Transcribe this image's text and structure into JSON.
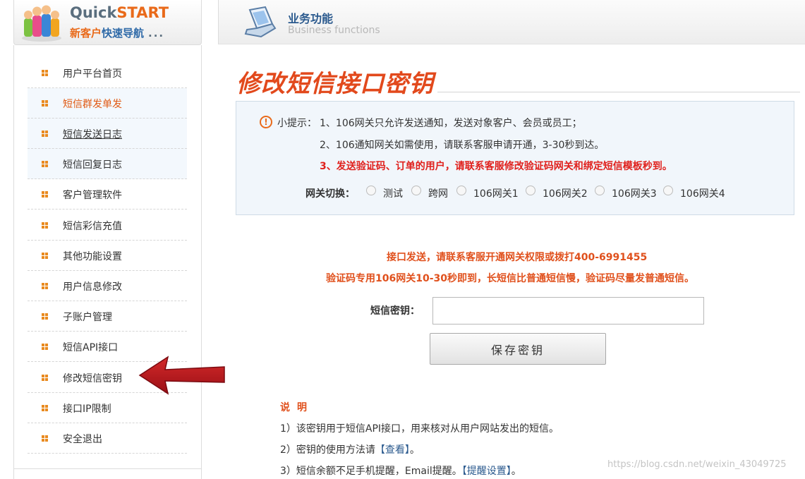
{
  "quickstart": {
    "title_part1": "Quick",
    "title_part2": "START",
    "subtitle_part1": "新客户",
    "subtitle_part2": "快速导航",
    "subtitle_dots": "...",
    "logo_icon": "users-group-icon"
  },
  "sidebar": {
    "bullet_icon": "square-bullet-icon",
    "items": [
      {
        "label": "用户平台首页"
      },
      {
        "label": "短信群发单发"
      },
      {
        "label": "短信发送日志"
      },
      {
        "label": "短信回复日志"
      },
      {
        "label": "客户管理软件"
      },
      {
        "label": "短信彩信充值"
      },
      {
        "label": "其他功能设置"
      },
      {
        "label": "用户信息修改"
      },
      {
        "label": "子账户管理"
      },
      {
        "label": "短信API接口"
      },
      {
        "label": "修改短信密钥"
      },
      {
        "label": "接口IP限制"
      },
      {
        "label": "安全退出"
      }
    ]
  },
  "header": {
    "title": "业务功能",
    "subtitle": "Business functions",
    "icon": "laptop-icon"
  },
  "page": {
    "title": "修改短信接口密钥"
  },
  "tips": {
    "prefix": "小提示：",
    "line1": "1、106网关只允许发送通知，发送对象客户、会员或员工；",
    "line2": "2、106通知网关如需使用，请联系客服申请开通，3-30秒到达。",
    "line3": "3、发送验证码、订单的用户，请联系客服修改验证码网关和绑定短信模板秒到。",
    "icon": "warning-circle-icon"
  },
  "gateway": {
    "label": "网关切换：",
    "options": [
      {
        "label": "测试"
      },
      {
        "label": "跨网"
      },
      {
        "label": "106网关1"
      },
      {
        "label": "106网关2"
      },
      {
        "label": "106网关3"
      },
      {
        "label": "106网关4"
      }
    ]
  },
  "notice": {
    "line1": "接口发送，请联系客服开通网关权限或拨打400-6991455",
    "line2": "验证码专用106网关10-30秒即到，长短信比普通短信慢，验证码尽量发普通短信。"
  },
  "form": {
    "key_label": "短信密钥：",
    "key_value": "",
    "save_label": "保存密钥"
  },
  "description": {
    "title": "说明",
    "line1": "1）该密钥用于短信API接口，用来核对从用户网站发出的短信。",
    "line2_prefix": "2）密钥的使用方法请",
    "line2_link": "【查看】",
    "line2_suffix": "。",
    "line3_prefix": "3）短信余额不足手机提醒，Email提醒。",
    "line3_link": "【提醒设置】",
    "line3_suffix": "。"
  },
  "watermark": "https://blog.csdn.net/weixin_43049725",
  "colors": {
    "accent_orange": "#e96a1a",
    "title_red": "#e2491c",
    "tip_red": "#e0201c",
    "link_blue": "#2b5a8e",
    "arrow_red": "#b8141c"
  }
}
